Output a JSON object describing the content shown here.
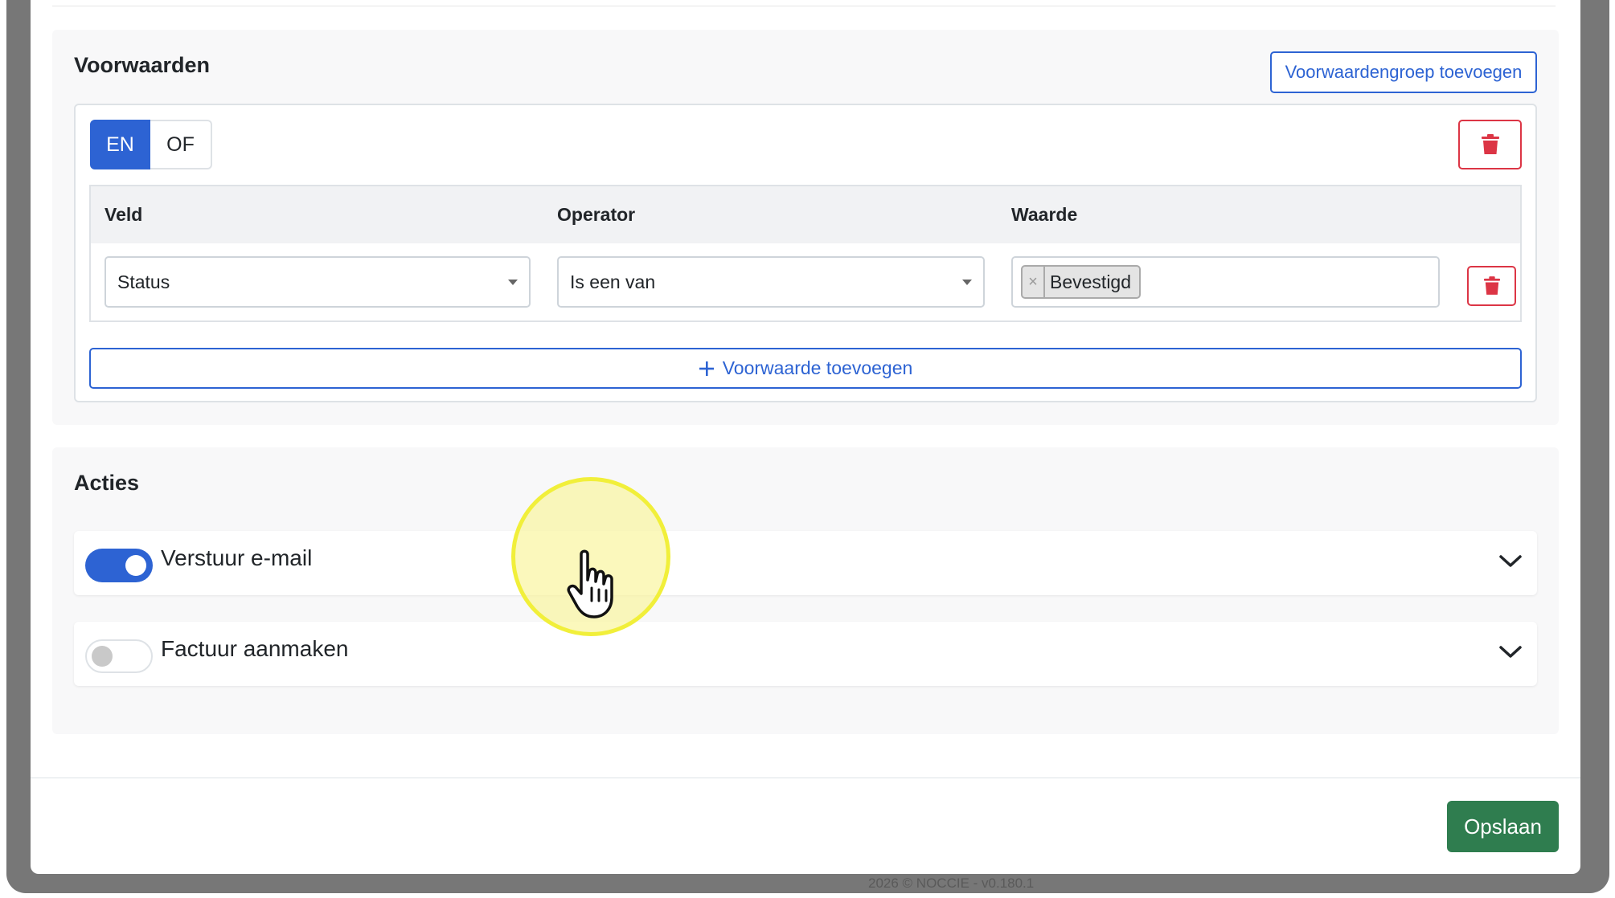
{
  "conditions": {
    "heading": "Voorwaarden",
    "add_group_label": "Voorwaardengroep toevoegen",
    "logic_toggle": {
      "and_label": "EN",
      "or_label": "OF",
      "selected": "EN"
    },
    "table": {
      "columns": [
        "Veld",
        "Operator",
        "Waarde"
      ],
      "row": {
        "field": "Status",
        "operator": "Is een van",
        "values": [
          "Bevestigd"
        ],
        "remove_tag_symbol": "×"
      }
    },
    "add_condition_label": "Voorwaarde toevoegen",
    "add_condition_icon": "plus-icon"
  },
  "actions": {
    "heading": "Acties",
    "items": [
      {
        "label": "Verstuur e-mail",
        "enabled": true
      },
      {
        "label": "Factuur aanmaken",
        "enabled": false
      }
    ]
  },
  "footer": {
    "save_label": "Opslaan",
    "copyright": "2026 © NOCCIE - v0.180.1"
  },
  "colors": {
    "primary": "#2d63d3",
    "danger": "#dc3545",
    "success": "#2f7d4f",
    "cursor_highlight": "#f1ef3a"
  },
  "icons": {
    "delete": "trash-icon",
    "expand": "chevron-down-icon",
    "cursor": "hand-pointer-icon"
  }
}
